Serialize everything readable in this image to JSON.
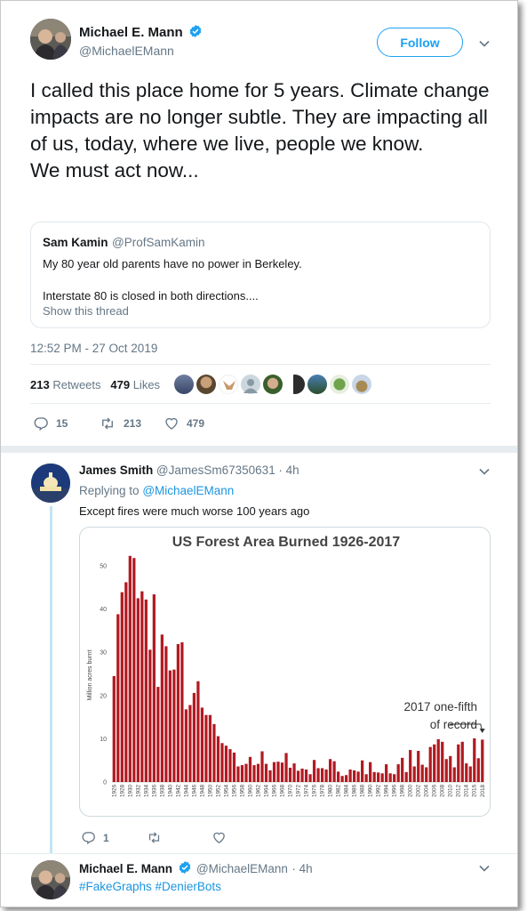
{
  "tweet": {
    "author_name": "Michael E. Mann",
    "author_handle": "@MichaelEMann",
    "follow_label": "Follow",
    "text": "I called this place home for 5 years. Climate change impacts are no longer subtle. They are impacting all of us, today, where we live, people we know.\nWe must act now...",
    "quote": {
      "name": "Sam Kamin",
      "handle": "@ProfSamKamin",
      "text": "My 80 year old parents have no power in Berkeley.\n\nInterstate 80 is closed in both directions....",
      "link": "Show this thread"
    },
    "timestamp": "12:52 PM - 27 Oct 2019",
    "retweets_count": "213",
    "retweets_label": "Retweets",
    "likes_count": "479",
    "likes_label": "Likes",
    "actions": {
      "replies": "15",
      "retweets": "213",
      "likes": "479"
    }
  },
  "reply1": {
    "author_name": "James Smith",
    "author_handle": "@JamesSm67350631",
    "time": "· 4h",
    "replying_prefix": "Replying to",
    "replying_to": "@MichaelEMann",
    "text": "Except fires were much worse 100 years ago",
    "actions": {
      "replies": "1",
      "retweets": "",
      "likes": ""
    }
  },
  "reply2": {
    "author_name": "Michael E. Mann",
    "author_handle": "@MichaelEMann",
    "time": "· 4h",
    "text": "#FakeGraphs #DenierBots"
  },
  "colors": {
    "accent": "#1da1f2",
    "link": "#1b95e0",
    "bar": "#b11a21",
    "muted": "#657786"
  },
  "chart_data": {
    "type": "bar",
    "title": "US Forest Area Burned 1926-2017",
    "ylabel": "Million acres burnt",
    "ylim": [
      0,
      50
    ],
    "yticks": [
      0,
      10,
      20,
      30,
      40,
      50
    ],
    "x_start": 1926,
    "x_end": 2017,
    "annotation": "2017 one-fifth\nof record",
    "values": [
      24.5,
      38.8,
      43.9,
      46.2,
      52.3,
      51.8,
      42.5,
      44.1,
      42.2,
      30.6,
      43.4,
      22.0,
      34.1,
      31.4,
      25.8,
      26.0,
      31.9,
      32.3,
      16.8,
      17.8,
      20.6,
      23.3,
      17.2,
      15.5,
      15.5,
      13.4,
      10.6,
      9.0,
      8.4,
      7.6,
      6.8,
      3.6,
      3.9,
      4.2,
      5.8,
      3.9,
      4.2,
      7.1,
      4.2,
      2.7,
      4.6,
      4.7,
      4.5,
      6.7,
      3.3,
      4.3,
      2.6,
      3.1,
      2.9,
      1.8,
      5.1,
      3.2,
      3.2,
      2.9,
      5.3,
      4.8,
      2.4,
      1.4,
      1.6,
      2.9,
      2.7,
      2.4,
      5.0,
      1.8,
      4.6,
      2.3,
      2.2,
      2.0,
      4.1,
      2.0,
      1.8,
      4.1,
      5.6,
      2.3,
      7.4,
      3.6,
      7.2,
      4.0,
      3.4,
      8.1,
      8.7,
      9.9,
      9.3,
      5.3,
      6.0,
      3.4,
      8.7,
      9.3,
      4.3,
      3.6,
      10.1,
      5.5,
      9.8
    ]
  }
}
